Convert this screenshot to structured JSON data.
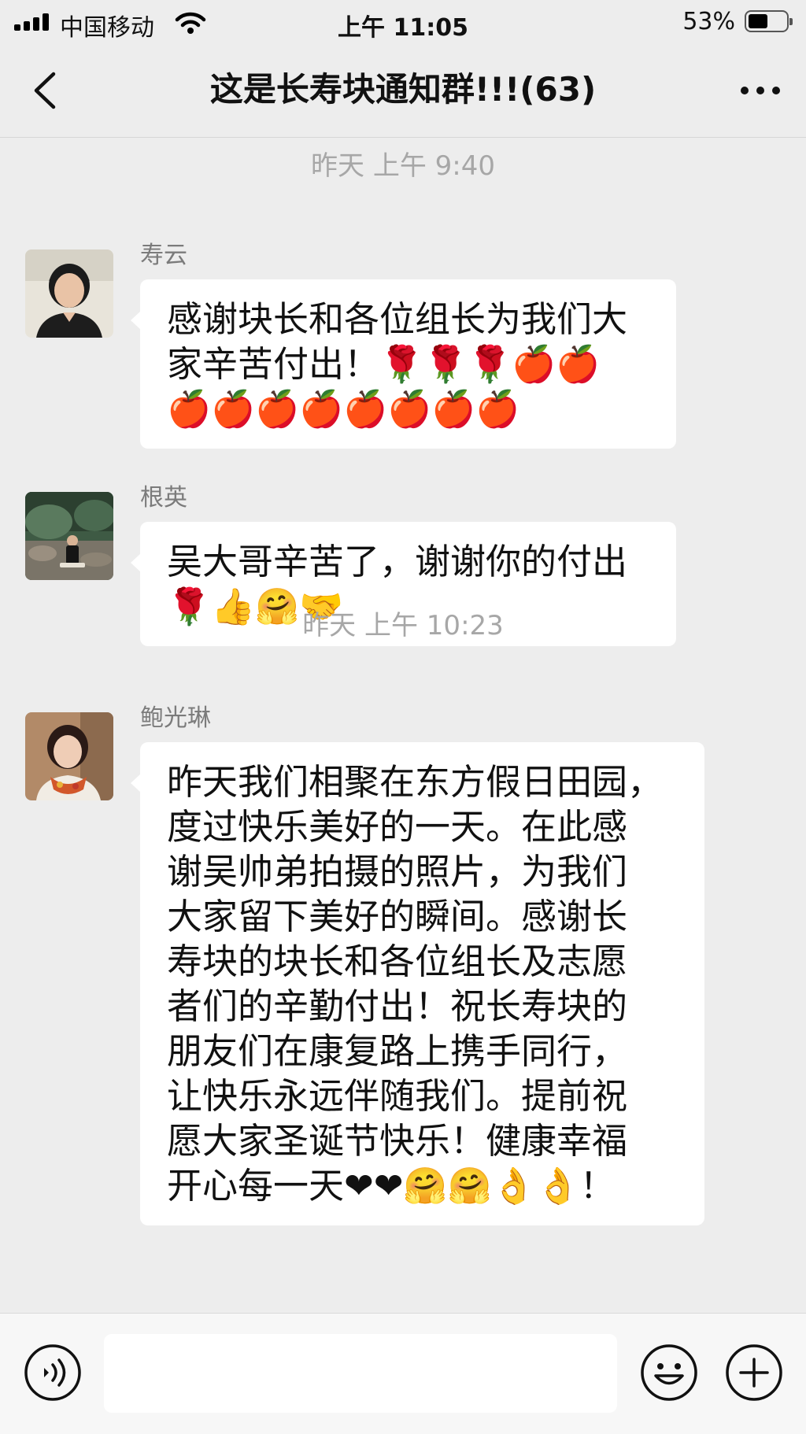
{
  "status_bar": {
    "carrier": "中国移动",
    "time": "上午 11:05",
    "battery_percent": "53%",
    "battery_level": 0.53
  },
  "header": {
    "title": "这是长寿块通知群!!!(63)",
    "back_icon": "chevron-left-icon",
    "more_icon": "more-dots-icon"
  },
  "chat": {
    "timestamps": [
      "昨天 上午 9:40",
      "昨天 上午 10:23"
    ],
    "messages": [
      {
        "sender": "寿云",
        "text": "感谢块长和各位组长为我们大\n家辛苦付出！🌹🌹🌹🍎🍎\n🍎🍎🍎🍎🍎🍎🍎🍎"
      },
      {
        "sender": "根英",
        "text": "吴大哥辛苦了，谢谢你的付出\n🌹👍🤗🤝"
      },
      {
        "sender": "鲍光琳",
        "text": "昨天我们相聚在东方假日田园，\n度过快乐美好的一天。在此感\n谢吴帅弟拍摄的照片，为我们\n大家留下美好的瞬间。感谢长\n寿块的块长和各位组长及志愿\n者们的辛勤付出！祝长寿块的\n朋友们在康复路上携手同行，\n让快乐永远伴随我们。提前祝\n愿大家圣诞节快乐！健康幸福\n开心每一天❤❤🤗🤗👌👌！"
      }
    ]
  },
  "input_bar": {
    "voice_icon": "voice-icon",
    "emoji_icon": "emoji-icon",
    "plus_icon": "plus-icon",
    "input_value": ""
  }
}
